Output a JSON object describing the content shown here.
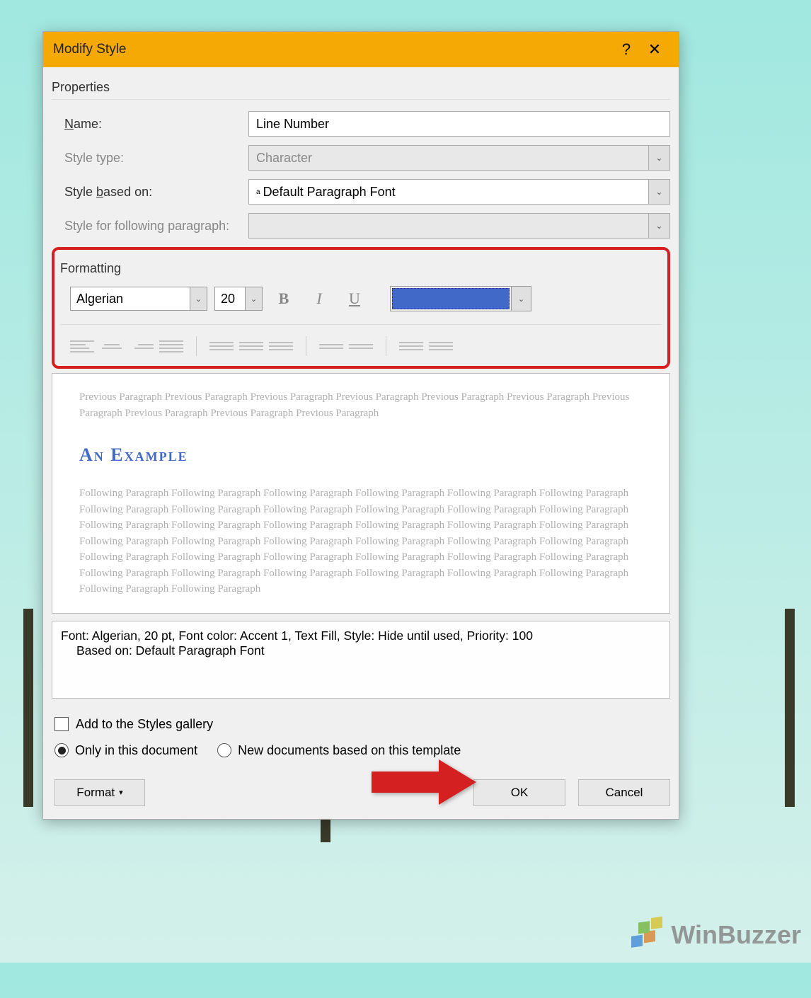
{
  "titlebar": {
    "title": "Modify Style"
  },
  "properties": {
    "section": "Properties",
    "name_label": "Name:",
    "name_underline": "N",
    "name_value": "Line Number",
    "type_label": "Style type:",
    "type_value": "Character",
    "based_label_pre": "Style ",
    "based_underline": "b",
    "based_label_post": "ased on:",
    "based_value": "Default Paragraph Font",
    "following_label": "Style for following paragraph:",
    "following_value": ""
  },
  "formatting": {
    "section": "Formatting",
    "font": "Algerian",
    "size": "20",
    "color": "#4169c8",
    "bold": "B",
    "italic": "I",
    "underline": "U"
  },
  "preview": {
    "previous": "Previous Paragraph Previous Paragraph Previous Paragraph Previous Paragraph Previous Paragraph Previous Paragraph Previous Paragraph Previous Paragraph Previous Paragraph Previous Paragraph",
    "sample": "An Example",
    "following": "Following Paragraph Following Paragraph Following Paragraph Following Paragraph Following Paragraph Following Paragraph Following Paragraph Following Paragraph Following Paragraph Following Paragraph Following Paragraph Following Paragraph Following Paragraph Following Paragraph Following Paragraph Following Paragraph Following Paragraph Following Paragraph Following Paragraph Following Paragraph Following Paragraph Following Paragraph Following Paragraph Following Paragraph Following Paragraph Following Paragraph Following Paragraph Following Paragraph Following Paragraph Following Paragraph Following Paragraph Following Paragraph Following Paragraph Following Paragraph Following Paragraph Following Paragraph Following Paragraph Following Paragraph"
  },
  "description": {
    "line1": "Font: Algerian, 20 pt, Font color: Accent 1, Text Fill, Style: Hide until used, Priority: 100",
    "line2": "Based on: Default Paragraph Font"
  },
  "footer": {
    "gallery_pre": "Add to the ",
    "gallery_u": "S",
    "gallery_post": "tyles gallery",
    "radio1_pre": "Only in this ",
    "radio1_u": "d",
    "radio1_post": "ocument",
    "radio2": "New documents based on this template",
    "format_btn_pre": "F",
    "format_btn_u": "o",
    "format_btn_post": "rmat",
    "ok": "OK",
    "cancel": "Cancel"
  },
  "watermark": "WinBuzzer"
}
